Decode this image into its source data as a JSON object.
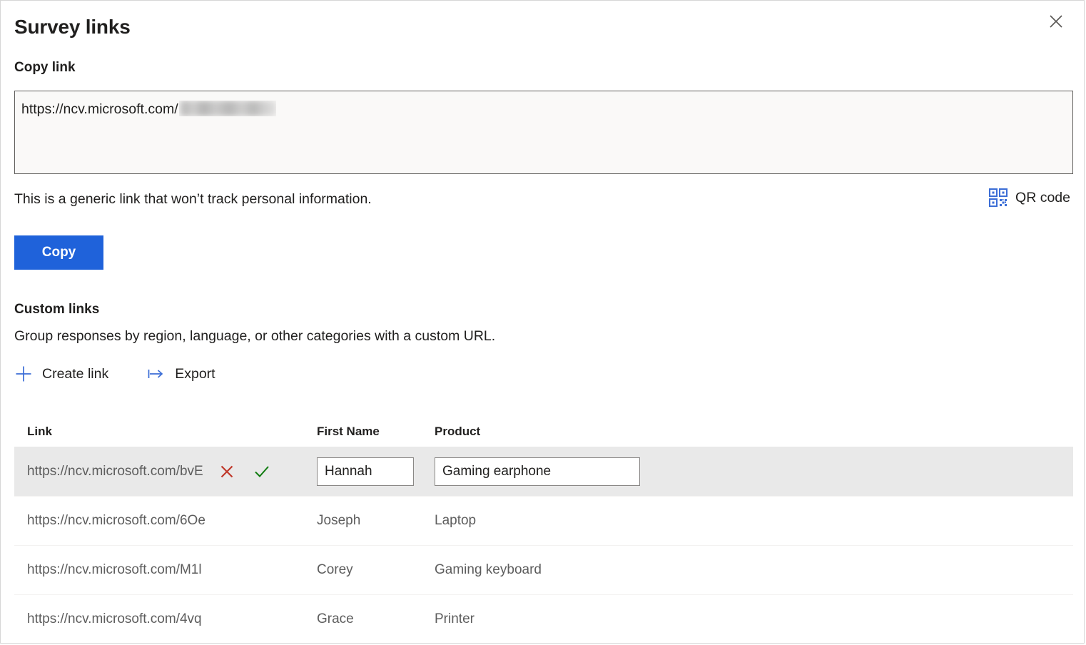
{
  "panel": {
    "title": "Survey links",
    "close_icon": "close-icon"
  },
  "copy_link": {
    "label": "Copy link",
    "url_prefix": "https://ncv.microsoft.com/",
    "url_redacted": true,
    "note": "This is a generic link that won’t track personal information.",
    "qr": {
      "label": "QR code",
      "icon": "qr-code-icon"
    },
    "copy_button": "Copy"
  },
  "custom_links": {
    "title": "Custom links",
    "description": "Group responses by region, language, or other categories with a custom URL.",
    "commands": [
      {
        "label": "Create link",
        "icon": "plus-icon"
      },
      {
        "label": "Export",
        "icon": "export-arrow-icon"
      }
    ],
    "columns": [
      {
        "key": "link",
        "label": "Link"
      },
      {
        "key": "first_name",
        "label": "First Name"
      },
      {
        "key": "product",
        "label": "Product"
      }
    ],
    "rows": [
      {
        "link": "https://ncv.microsoft.com/bvE",
        "first_name": "Hannah",
        "product": "Gaming earphone",
        "editing": true,
        "actions": [
          {
            "name": "cancel-edit",
            "icon": "x-icon",
            "color": "#c0392b"
          },
          {
            "name": "confirm-edit",
            "icon": "check-icon",
            "color": "#107c10"
          }
        ]
      },
      {
        "link": "https://ncv.microsoft.com/6Oe",
        "first_name": "Joseph",
        "product": "Laptop",
        "editing": false
      },
      {
        "link": "https://ncv.microsoft.com/M1l",
        "first_name": "Corey",
        "product": "Gaming keyboard",
        "editing": false
      },
      {
        "link": "https://ncv.microsoft.com/4vq",
        "first_name": "Grace",
        "product": "Printer",
        "editing": false
      }
    ]
  },
  "colors": {
    "accent_blue": "#1f62da",
    "icon_blue": "#3b6dd6",
    "selected_row": "#e9e9e9",
    "textarea_bg": "#faf9f8",
    "border": "#605e5c",
    "delete_red": "#c0392b",
    "confirm_green": "#107c10"
  }
}
